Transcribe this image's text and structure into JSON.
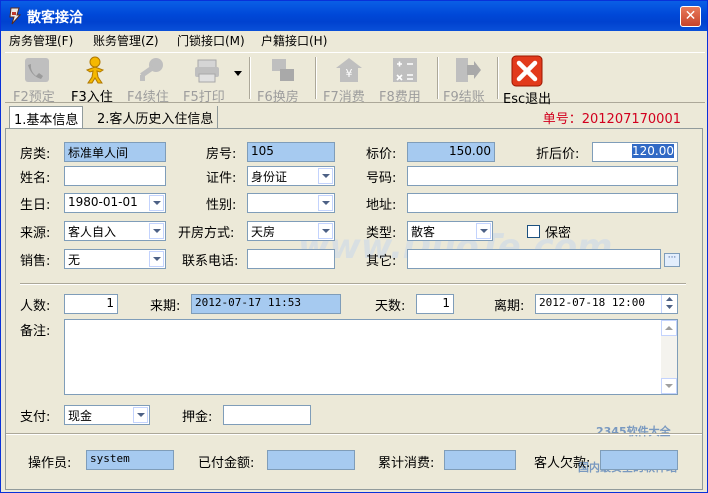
{
  "window": {
    "title": "散客接洽"
  },
  "menu": [
    "房务管理(F)",
    "账务管理(Z)",
    "门锁接口(M)",
    "户籍接口(H)"
  ],
  "toolbar": [
    {
      "label": "F2预定",
      "icon": "phone-icon",
      "enabled": false
    },
    {
      "label": "F3入住",
      "icon": "person-icon",
      "enabled": true
    },
    {
      "label": "F4续住",
      "icon": "key-icon",
      "enabled": false
    },
    {
      "label": "F5打印",
      "icon": "printer-icon",
      "enabled": false
    },
    {
      "label": "F6换房",
      "icon": "swap-icon",
      "enabled": false
    },
    {
      "label": "F7消费",
      "icon": "yen-house-icon",
      "enabled": false
    },
    {
      "label": "F8费用",
      "icon": "calculator-icon",
      "enabled": false
    },
    {
      "label": "F9结账",
      "icon": "exit-door-icon",
      "enabled": false
    },
    {
      "label": "Esc退出",
      "icon": "red-x-icon",
      "enabled": true
    }
  ],
  "tabs": [
    "1.基本信息",
    "2.客人历史入住信息"
  ],
  "order": {
    "label": "单号：",
    "value": "201207170001"
  },
  "form": {
    "room_type_label": "房类:",
    "room_type": "标准单人间",
    "room_no_label": "房号:",
    "room_no": "105",
    "list_price_label": "标价:",
    "list_price": "150.00",
    "discount_price_label": "折后价:",
    "discount_price": "120.00",
    "name_label": "姓名:",
    "name": "",
    "id_type_label": "证件:",
    "id_type": "身份证",
    "id_no_label": "号码:",
    "id_no": "",
    "birthday_label": "生日:",
    "birthday": "1980-01-01",
    "gender_label": "性别:",
    "gender": "",
    "address_label": "地址:",
    "address": "",
    "source_label": "来源:",
    "source": "客人自入",
    "open_mode_label": "开房方式:",
    "open_mode": "天房",
    "type_label": "类型:",
    "type": "散客",
    "confidential_label": "保密",
    "sales_label": "销售:",
    "sales": "无",
    "phone_label": "联系电话:",
    "phone": "",
    "other_label": "其它:",
    "other": "",
    "persons_label": "人数:",
    "persons": "1",
    "arrival_label": "来期:",
    "arrival": "2012-07-17 11:53",
    "days_label": "天数:",
    "days": "1",
    "departure_label": "离期:",
    "departure": "2012-07-18 12:00",
    "remark_label": "备注:",
    "payment_label": "支付:",
    "payment": "现金",
    "deposit_label": "押金:",
    "deposit": "",
    "operator_label": "操作员:",
    "operator": "system",
    "paid_label": "已付金额:",
    "paid": "",
    "consumption_label": "累计消费:",
    "consumption": "",
    "owed_label": "客人欠款:",
    "owed": ""
  },
  "watermark": {
    "text": "www.DuoTe.com",
    "brand": "2345软件大全",
    "slogan": "国内最安全的软件站"
  },
  "colors": {
    "title_blue": "#0048D8",
    "field_blue": "#A6CAF0",
    "order_red": "#D2001E",
    "window_bg": "#ECE9D8"
  }
}
